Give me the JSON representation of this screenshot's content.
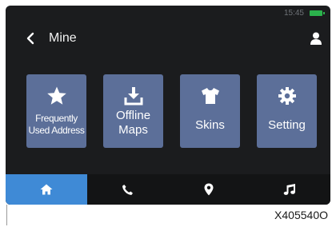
{
  "status_bar": {
    "time": "15:45",
    "battery_icon": "battery-icon",
    "battery_color": "#2bb24c"
  },
  "header": {
    "back_icon": "chevron-left-icon",
    "title": "Mine",
    "user_icon": "user-icon"
  },
  "tiles": [
    {
      "icon": "star-icon",
      "label_line1": "Frequently",
      "label_line2": "Used Address"
    },
    {
      "icon": "download-icon",
      "label_line1": "Offline",
      "label_line2": "Maps"
    },
    {
      "icon": "tshirt-icon",
      "label": "Skins"
    },
    {
      "icon": "gear-icon",
      "label": "Setting"
    }
  ],
  "bottom_nav": [
    {
      "icon": "home-icon",
      "active": true
    },
    {
      "icon": "phone-icon",
      "active": false
    },
    {
      "icon": "map-pin-icon",
      "active": false
    },
    {
      "icon": "music-note-icon",
      "active": false
    }
  ],
  "colors": {
    "background": "#1b1c1e",
    "tile": "#5c6f99",
    "active_tab": "#3f8ad6"
  },
  "figure_code": "X405540O"
}
